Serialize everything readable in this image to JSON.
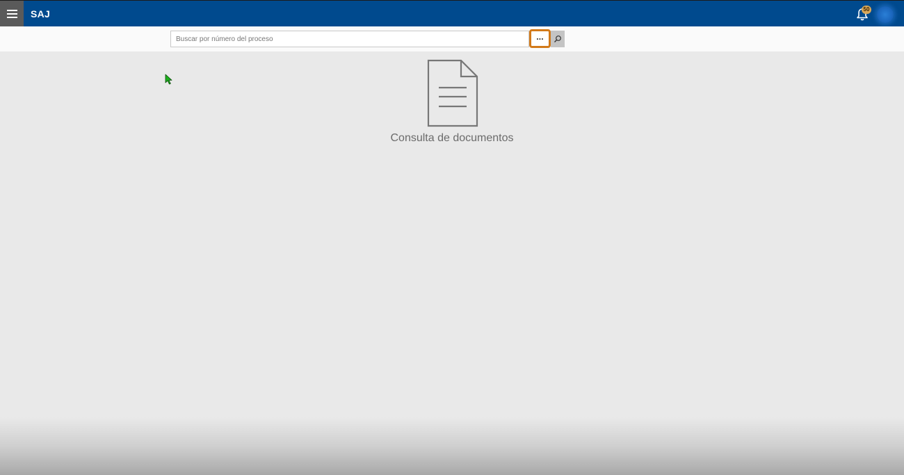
{
  "app": {
    "brand": "SAJ",
    "notification_count": "50"
  },
  "search": {
    "placeholder": "Buscar por número del proceso",
    "more_label": "···"
  },
  "main": {
    "empty_state_title": "Consulta de documentos"
  },
  "icons": {
    "menu": "hamburger-icon",
    "notifications": "bell-icon",
    "search": "magnifier-icon",
    "document": "document-icon",
    "cursor": "mouse-pointer-icon"
  },
  "colors": {
    "topbar": "#004a8e",
    "highlight": "#d27a1a",
    "badge": "#d9a85a",
    "background": "#e9e9e9"
  }
}
